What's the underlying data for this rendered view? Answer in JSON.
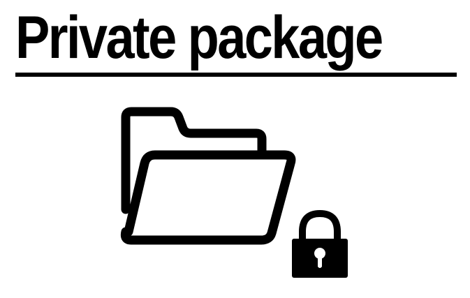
{
  "header": {
    "title": "Private package"
  },
  "illustration": {
    "folder_icon": "open-folder-icon",
    "lock_icon": "padlock-icon",
    "color": "#000000"
  }
}
